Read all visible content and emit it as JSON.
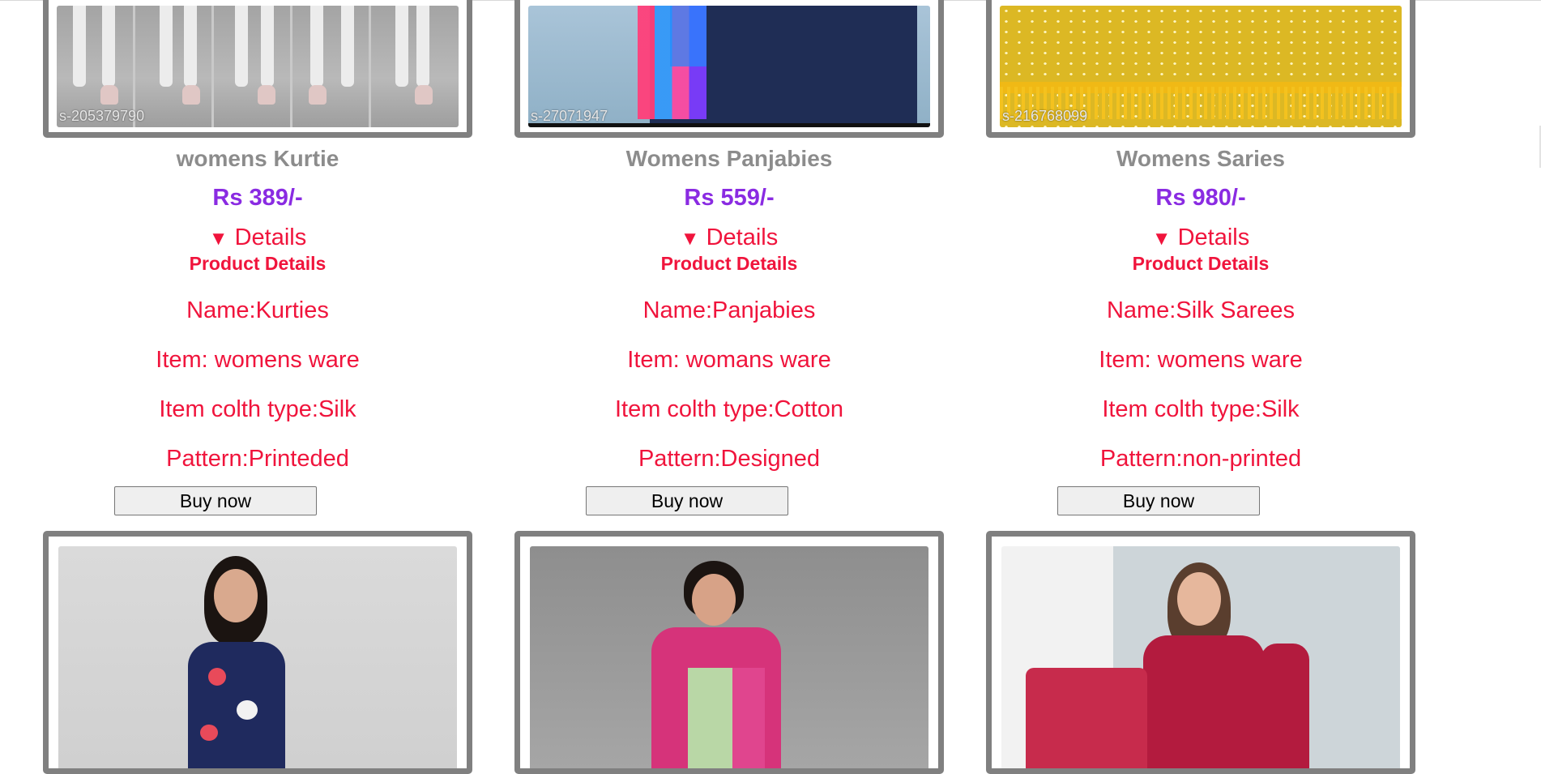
{
  "products": [
    {
      "image_code": "s-205379790",
      "name": "womens Kurtie",
      "price": "Rs 389/-",
      "details_label": "Details",
      "details_heading": "Product Details",
      "lines": [
        "Name:Kurties",
        "Item: womens ware",
        "Item colth type:Silk",
        "Pattern:Printeded"
      ],
      "buy_label": "Buy now"
    },
    {
      "image_code": "s-27071947",
      "name": "Womens Panjabies",
      "price": "Rs 559/-",
      "details_label": "Details",
      "details_heading": "Product Details",
      "lines": [
        "Name:Panjabies",
        "Item: womans ware",
        "Item colth type:Cotton",
        "Pattern:Designed"
      ],
      "buy_label": "Buy now"
    },
    {
      "image_code": "s-216768099",
      "name": "Womens Saries",
      "price": "Rs 980/-",
      "details_label": "Details",
      "details_heading": "Product Details",
      "lines": [
        "Name:Silk Sarees",
        "Item: womens ware",
        "Item colth type:Silk",
        "Pattern:non-printed"
      ],
      "buy_label": "Buy now"
    }
  ],
  "icons": {
    "details_toggle": "triangle-down-icon"
  },
  "colors": {
    "name_gray": "#8c8c8c",
    "price_purple": "#8a2be2",
    "details_red": "#f0143c",
    "frame_gray": "#808080"
  }
}
